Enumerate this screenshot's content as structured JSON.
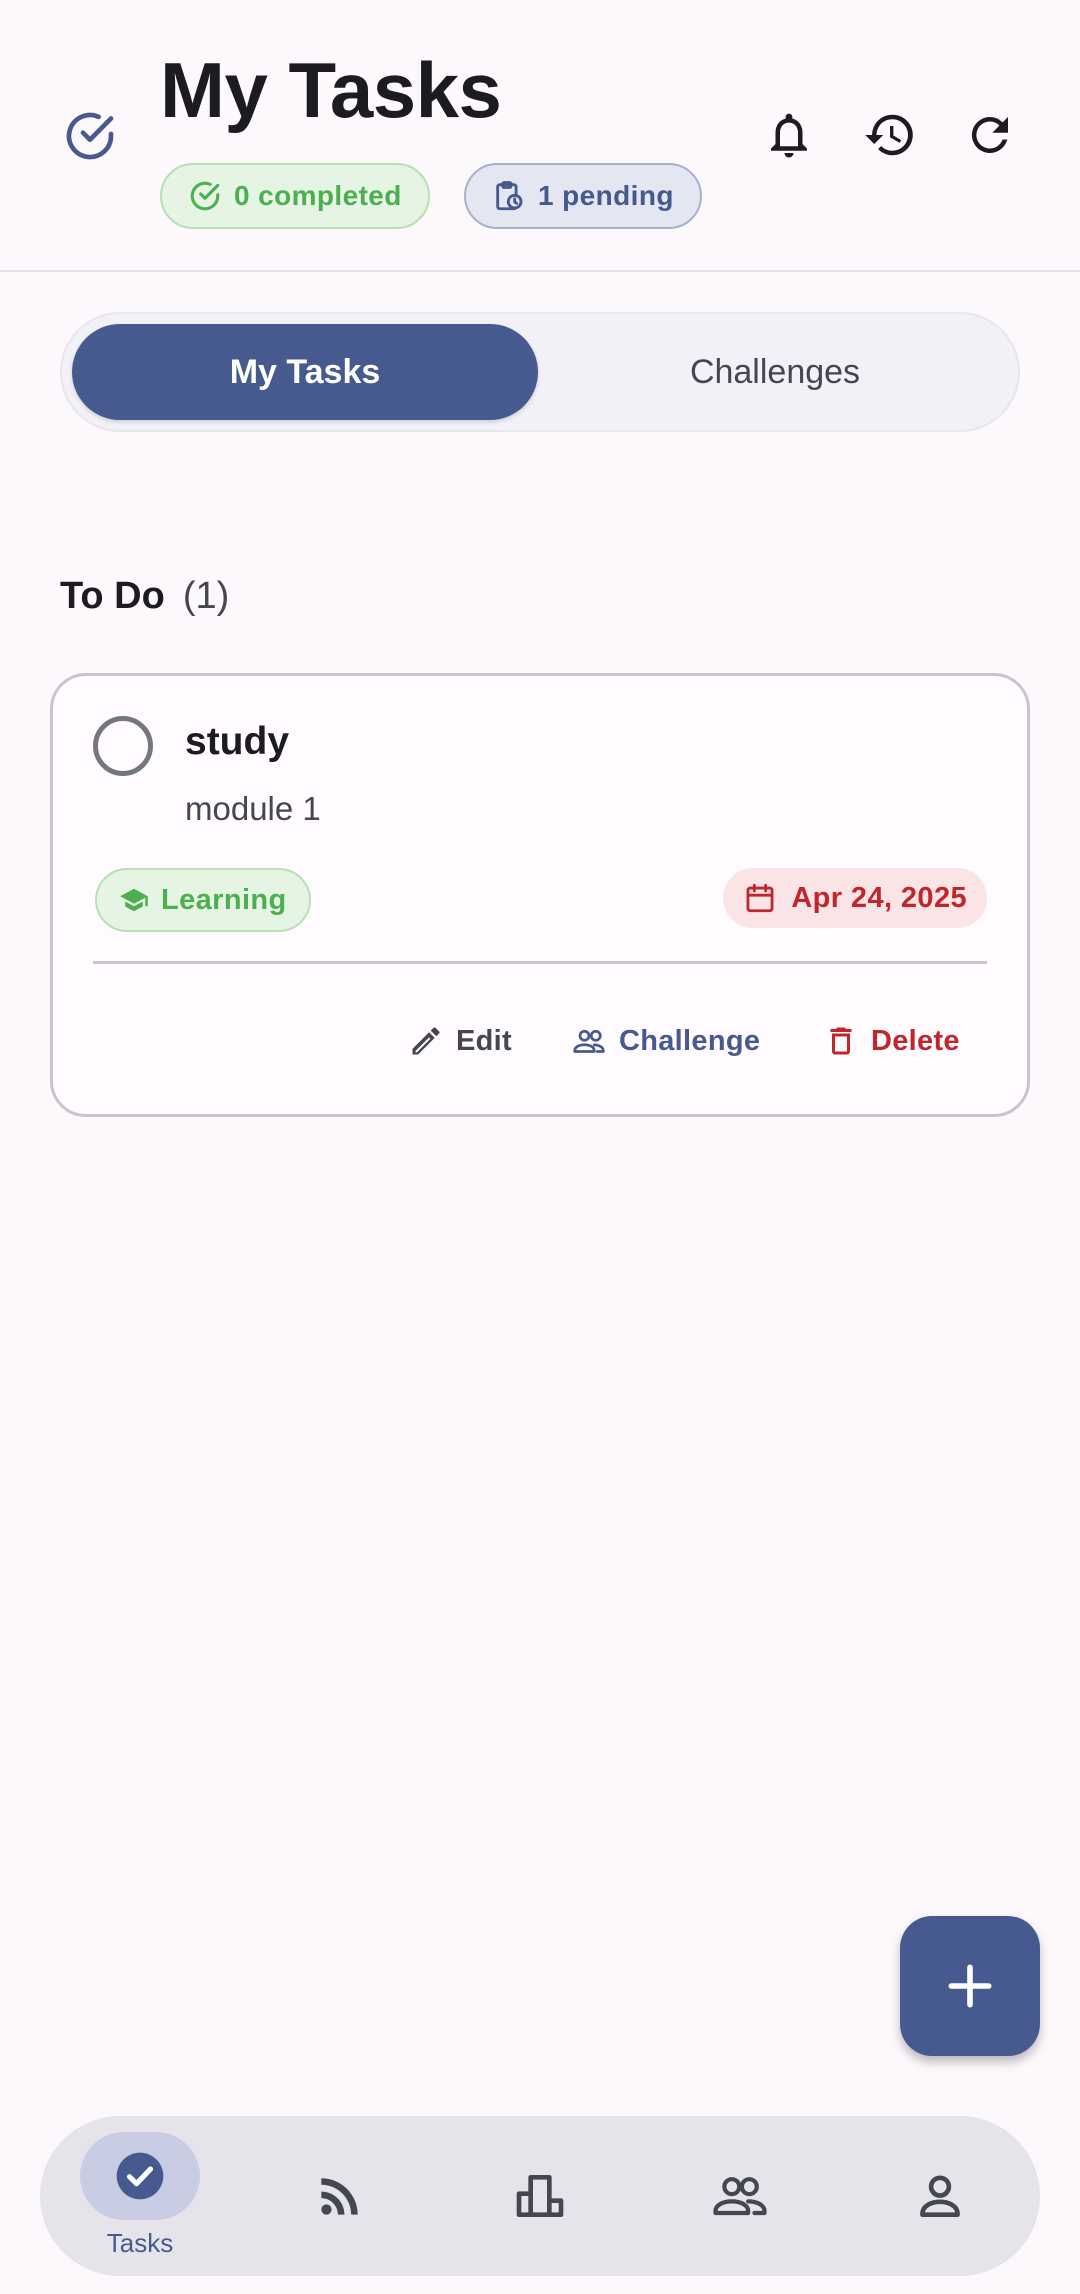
{
  "header": {
    "title": "My Tasks",
    "completed_label": "0 completed",
    "pending_label": "1 pending"
  },
  "tabs": [
    {
      "label": "My Tasks",
      "active": true
    },
    {
      "label": "Challenges",
      "active": false
    }
  ],
  "section": {
    "label": "To Do",
    "count": "(1)"
  },
  "task": {
    "title": "study",
    "description": "module 1",
    "category": "Learning",
    "due_date": "Apr 24, 2025",
    "completed": false,
    "actions": {
      "edit": "Edit",
      "challenge": "Challenge",
      "delete": "Delete"
    }
  },
  "bottom_nav": {
    "items": [
      {
        "label": "Tasks",
        "icon": "check-circle-icon",
        "active": true
      },
      {
        "label": "",
        "icon": "feed-icon",
        "active": false
      },
      {
        "label": "",
        "icon": "leaderboard-icon",
        "active": false
      },
      {
        "label": "",
        "icon": "friends-icon",
        "active": false
      },
      {
        "label": "",
        "icon": "profile-icon",
        "active": false
      }
    ]
  },
  "colors": {
    "primary": "#475a8f",
    "success": "#4caf50",
    "danger": "#c0272d",
    "background": "#fdf8fc"
  }
}
